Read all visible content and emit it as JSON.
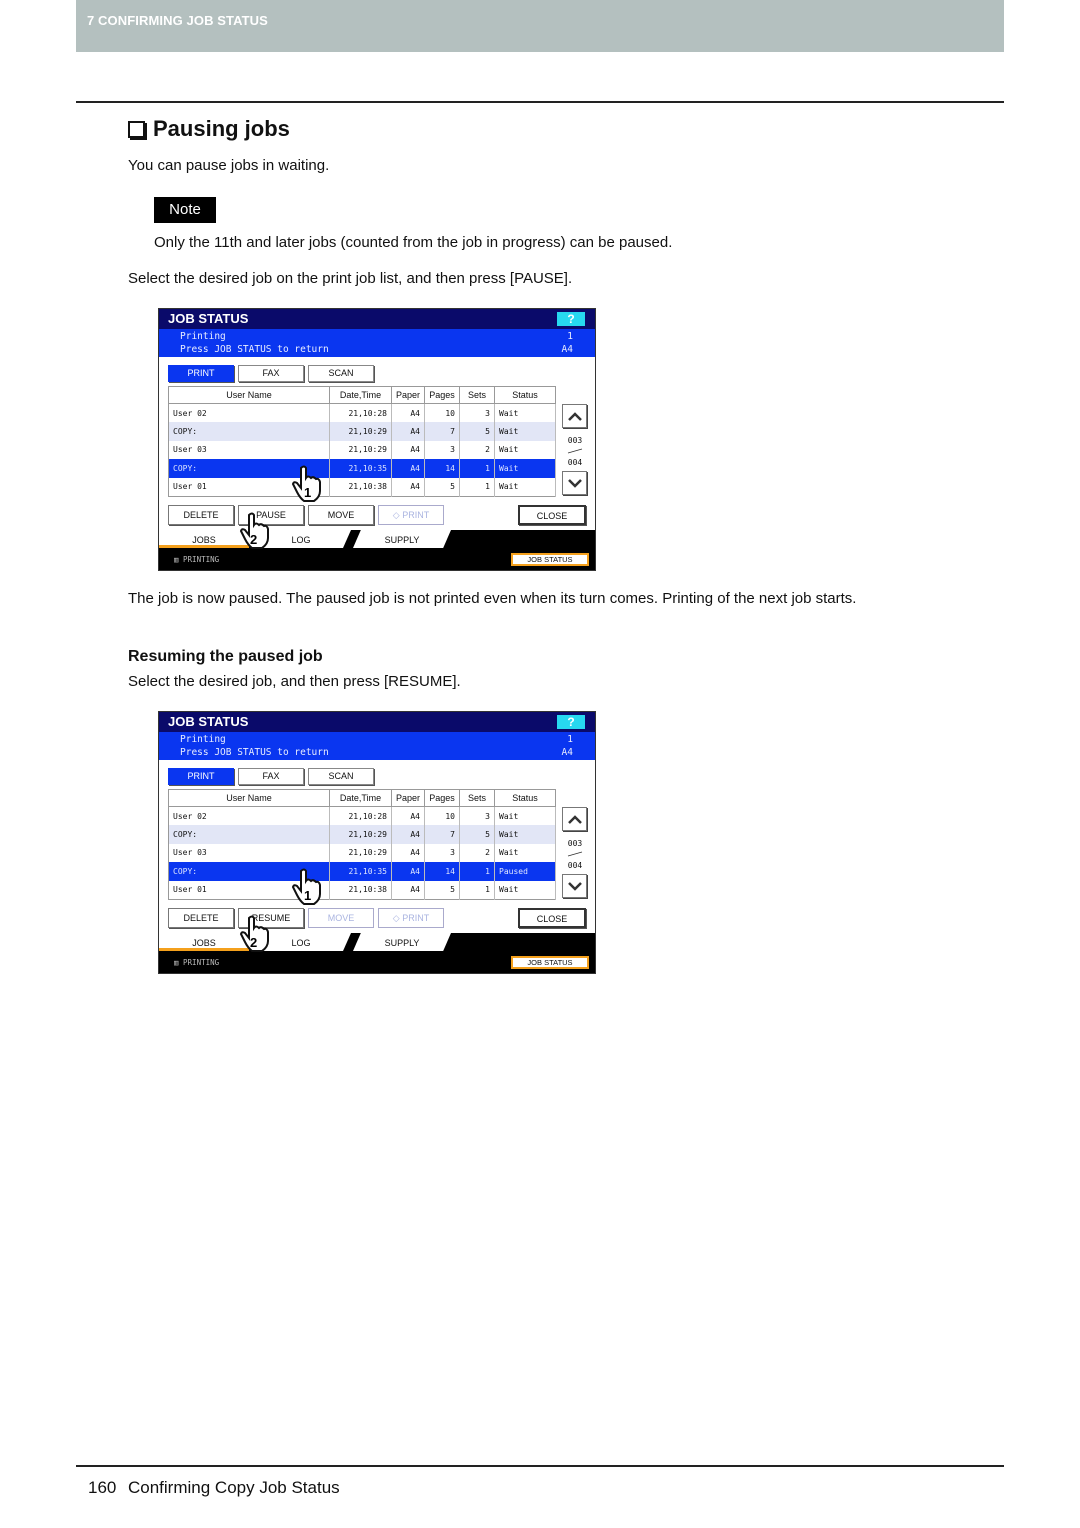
{
  "chapter": "7 CONFIRMING JOB STATUS",
  "section_title": "Pausing jobs",
  "intro": "You can pause jobs in waiting.",
  "note_label": "Note",
  "note_text": "Only the 11th and later jobs (counted from the job in progress) can be paused.",
  "step1": "Select the desired job on the print job list, and then press [PAUSE].",
  "after_pause": "The job is now paused. The paused job is not printed even when its turn comes. Printing of the next job starts.",
  "subsection_title": "Resuming the paused job",
  "step2": "Select the desired job, and then press [RESUME].",
  "footer": {
    "page_number": "160",
    "title": "Confirming Copy Job Status"
  },
  "panels": [
    {
      "header": "JOB STATUS",
      "help": "?",
      "status_line1": "Printing",
      "status_line2": "Press JOB STATUS to return",
      "status_right1": "1",
      "status_right2": "A4",
      "tabs": [
        "PRINT",
        "FAX",
        "SCAN"
      ],
      "columns": [
        "User Name",
        "Date,Time",
        "Paper",
        "Pages",
        "Sets",
        "Status"
      ],
      "rows": [
        [
          "User 02",
          "21,10:28",
          "A4",
          "10",
          "3",
          "Wait"
        ],
        [
          "COPY:",
          "21,10:29",
          "A4",
          "7",
          "5",
          "Wait"
        ],
        [
          "User 03",
          "21,10:29",
          "A4",
          "3",
          "2",
          "Wait"
        ],
        [
          "COPY:",
          "21,10:35",
          "A4",
          "14",
          "1",
          "Wait"
        ],
        [
          "User 01",
          "21,10:38",
          "A4",
          "5",
          "1",
          "Wait"
        ]
      ],
      "page_current": "003",
      "page_total": "004",
      "actions": [
        "DELETE",
        "PAUSE",
        "MOVE",
        "PRINT",
        "CLOSE"
      ],
      "bottom_tabs": [
        "JOBS",
        "LOG",
        "SUPPLY"
      ],
      "footer_status": "PRINTING",
      "job_status_button": "JOB STATUS",
      "callout1": "1",
      "callout2": "2"
    },
    {
      "header": "JOB STATUS",
      "help": "?",
      "status_line1": "Printing",
      "status_line2": "Press JOB STATUS to return",
      "status_right1": "1",
      "status_right2": "A4",
      "tabs": [
        "PRINT",
        "FAX",
        "SCAN"
      ],
      "columns": [
        "User Name",
        "Date,Time",
        "Paper",
        "Pages",
        "Sets",
        "Status"
      ],
      "rows": [
        [
          "User 02",
          "21,10:28",
          "A4",
          "10",
          "3",
          "Wait"
        ],
        [
          "COPY:",
          "21,10:29",
          "A4",
          "7",
          "5",
          "Wait"
        ],
        [
          "User 03",
          "21,10:29",
          "A4",
          "3",
          "2",
          "Wait"
        ],
        [
          "COPY:",
          "21,10:35",
          "A4",
          "14",
          "1",
          "Paused"
        ],
        [
          "User 01",
          "21,10:38",
          "A4",
          "5",
          "1",
          "Wait"
        ]
      ],
      "page_current": "003",
      "page_total": "004",
      "actions": [
        "DELETE",
        "RESUME",
        "MOVE",
        "PRINT",
        "CLOSE"
      ],
      "bottom_tabs": [
        "JOBS",
        "LOG",
        "SUPPLY"
      ],
      "footer_status": "PRINTING",
      "job_status_button": "JOB STATUS",
      "callout1": "1",
      "callout2": "2"
    }
  ]
}
